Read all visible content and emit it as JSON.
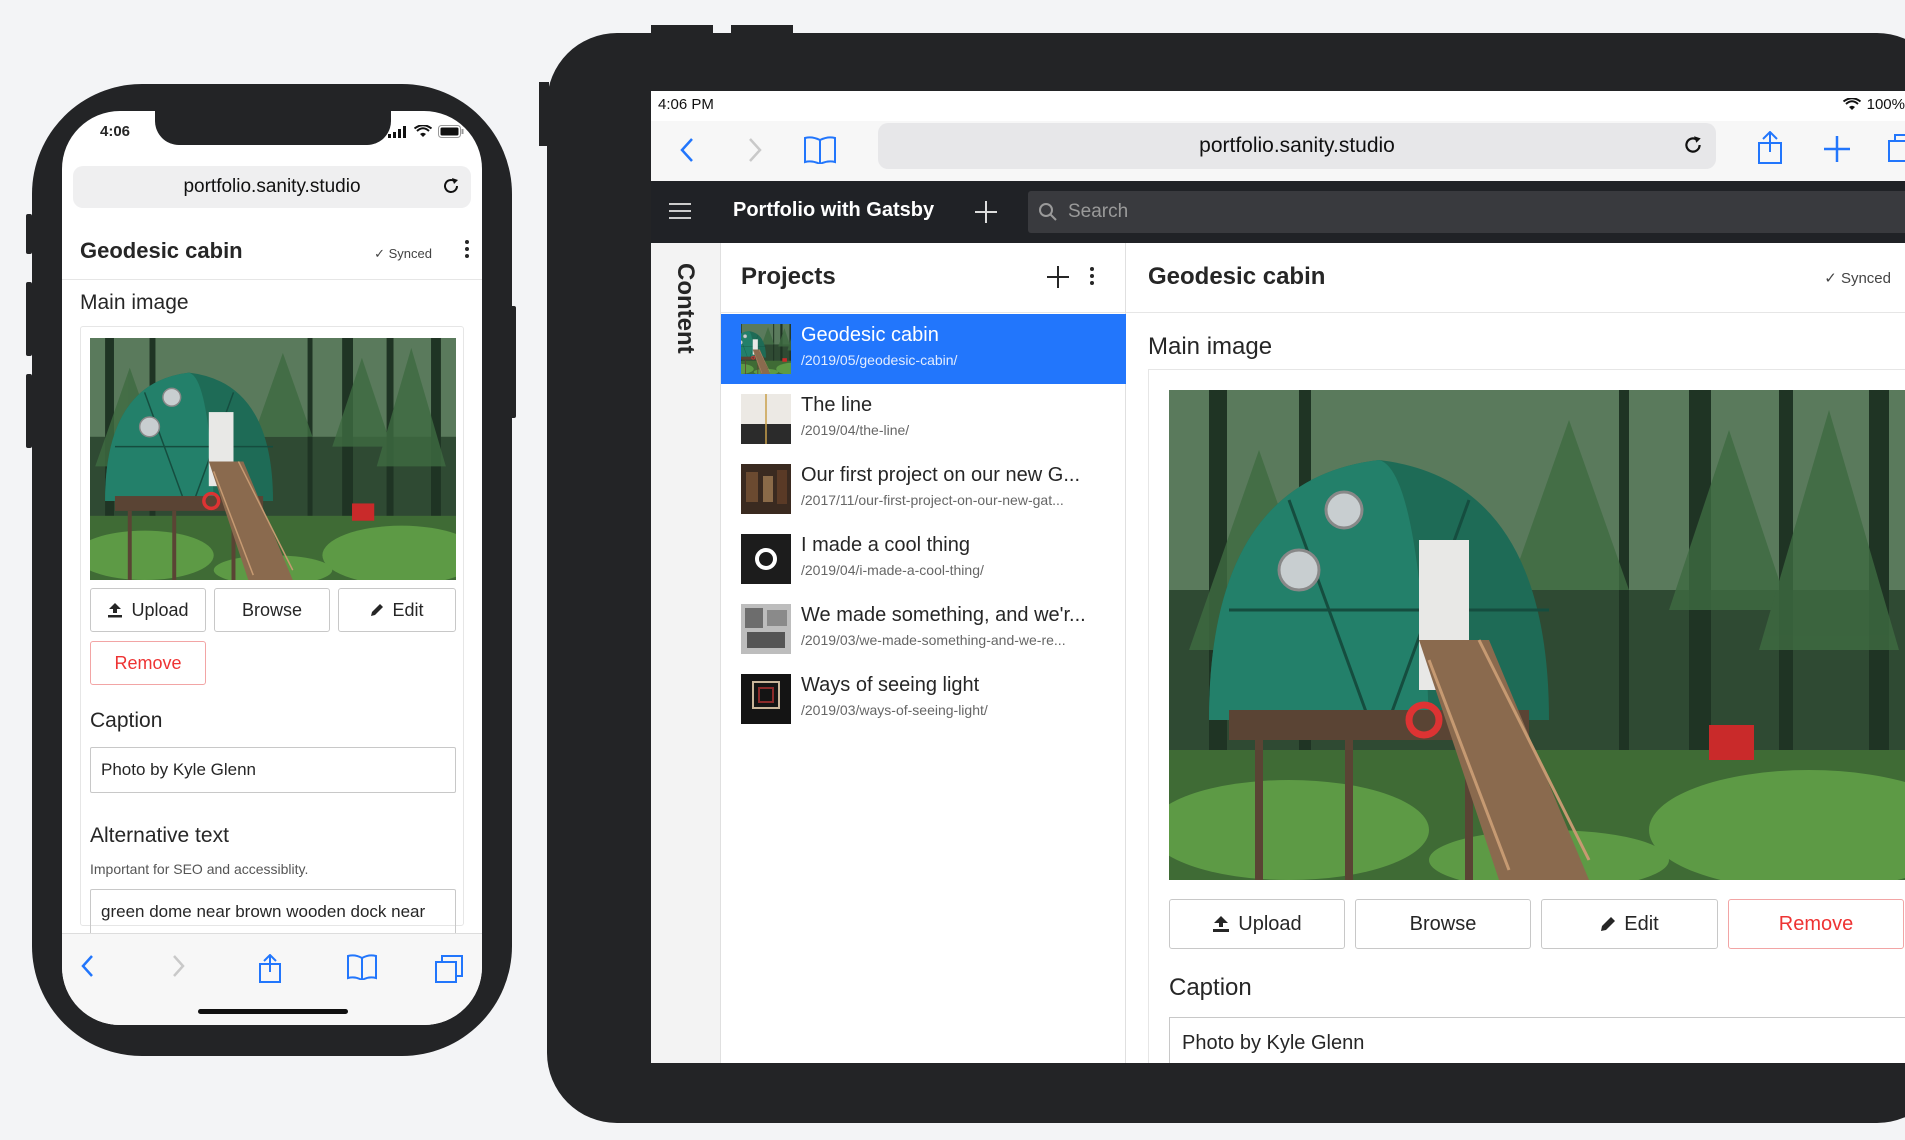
{
  "colors": {
    "background": "#f3f4f6",
    "device": "#232426",
    "accent": "#2276fc",
    "nav": "#202226",
    "danger": "#e33333"
  },
  "phone": {
    "status": {
      "time": "4:06"
    },
    "url": "portfolio.sanity.studio",
    "doc_title": "Geodesic cabin",
    "synced": "✓ Synced",
    "main_image_label": "Main image",
    "buttons": {
      "upload": "Upload",
      "browse": "Browse",
      "edit": "Edit",
      "remove": "Remove"
    },
    "caption_label": "Caption",
    "caption_value": "Photo by Kyle Glenn",
    "alt_label": "Alternative text",
    "alt_help": "Important for SEO and accessiblity.",
    "alt_value": "green dome near brown wooden dock near"
  },
  "tablet": {
    "status": {
      "time": "4:06 PM",
      "battery": "100%"
    },
    "url": "portfolio.sanity.studio",
    "brand": "Portfolio with Gatsby",
    "search_placeholder": "Search",
    "content_label": "Content",
    "projects_title": "Projects",
    "projects": [
      {
        "title": "Geodesic cabin",
        "slug": "/2019/05/geodesic-cabin/",
        "selected": true
      },
      {
        "title": "The line",
        "slug": "/2019/04/the-line/"
      },
      {
        "title": "Our first project on our new G...",
        "slug": "/2017/11/our-first-project-on-our-new-gat..."
      },
      {
        "title": "I made a cool thing",
        "slug": "/2019/04/i-made-a-cool-thing/"
      },
      {
        "title": "We made something, and we'r...",
        "slug": "/2019/03/we-made-something-and-we-re..."
      },
      {
        "title": "Ways of seeing light",
        "slug": "/2019/03/ways-of-seeing-light/"
      }
    ],
    "doc_title": "Geodesic cabin",
    "synced": "✓ Synced",
    "main_image_label": "Main image",
    "buttons": {
      "upload": "Upload",
      "browse": "Browse",
      "edit": "Edit",
      "remove": "Remove"
    },
    "caption_label": "Caption",
    "caption_value": "Photo by Kyle Glenn"
  }
}
